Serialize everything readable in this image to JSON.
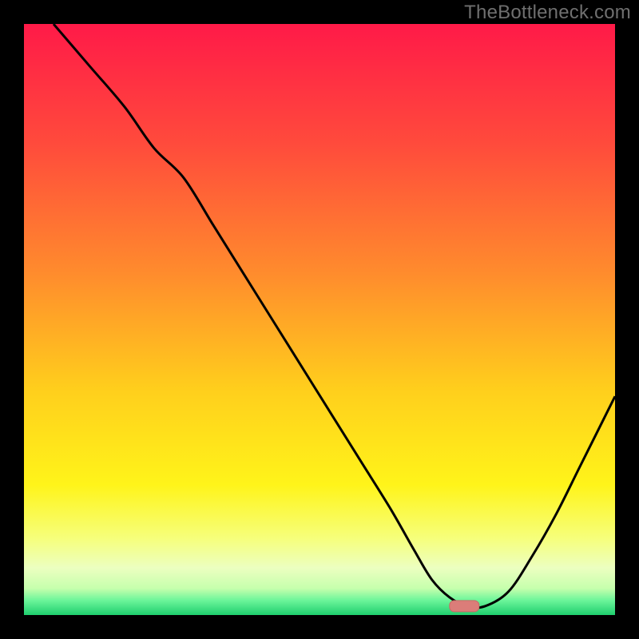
{
  "watermark": "TheBottleneck.com",
  "colors": {
    "frame": "#000000",
    "watermark": "#6f6f6f",
    "curve": "#000000",
    "marker_fill": "#db7d79",
    "marker_stroke": "#c86a66",
    "gradient_stops": [
      {
        "offset": 0.0,
        "color": "#ff1a48"
      },
      {
        "offset": 0.2,
        "color": "#ff4a3c"
      },
      {
        "offset": 0.42,
        "color": "#ff8b2d"
      },
      {
        "offset": 0.62,
        "color": "#ffcf1c"
      },
      {
        "offset": 0.78,
        "color": "#fff41a"
      },
      {
        "offset": 0.87,
        "color": "#f6ff7b"
      },
      {
        "offset": 0.92,
        "color": "#ecffc0"
      },
      {
        "offset": 0.955,
        "color": "#c6ffad"
      },
      {
        "offset": 0.975,
        "color": "#6cf59a"
      },
      {
        "offset": 1.0,
        "color": "#1fcf6e"
      }
    ]
  },
  "chart_data": {
    "type": "line",
    "title": "",
    "xlabel": "",
    "ylabel": "",
    "xlim": [
      0,
      100
    ],
    "ylim": [
      0,
      100
    ],
    "yaxis_inverted": false,
    "note": "x/y in percent of plot area; y=0 is bottom (green), y=100 is top (red). Curve descends from top-left, flattens near the bottom around x≈70–76, then rises toward the right edge.",
    "series": [
      {
        "name": "bottleneck-curve",
        "x": [
          5,
          11,
          17,
          22,
          27,
          32,
          37,
          42,
          47,
          52,
          57,
          62,
          66,
          69,
          72,
          75,
          78,
          82,
          86,
          90,
          94,
          98,
          100
        ],
        "y": [
          100,
          93,
          86,
          79,
          74,
          66,
          58,
          50,
          42,
          34,
          26,
          18,
          11,
          6,
          3,
          1.5,
          1.5,
          4,
          10,
          17,
          25,
          33,
          37
        ]
      }
    ],
    "marker": {
      "x_start": 72,
      "x_end": 77,
      "y": 1.5
    }
  }
}
